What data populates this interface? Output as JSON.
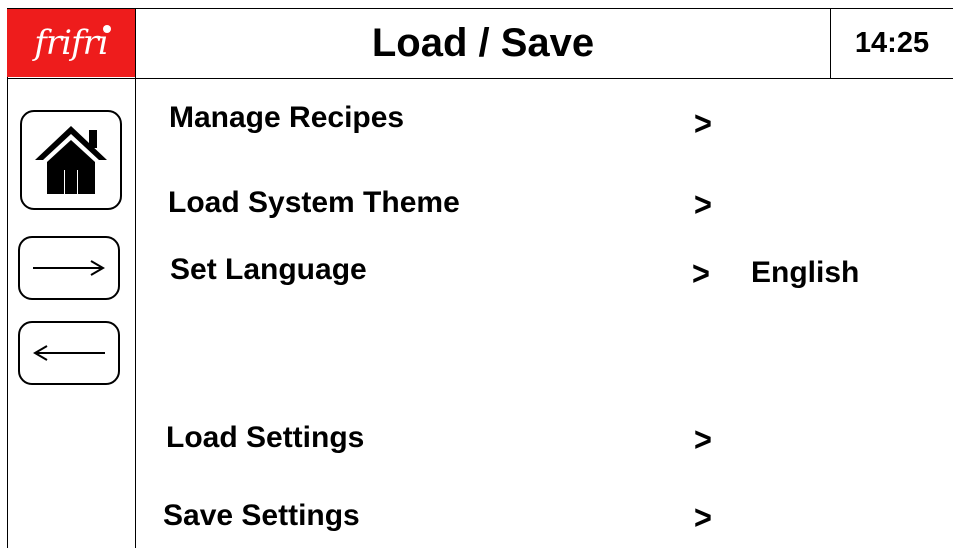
{
  "brand": {
    "logo_text": "frifri",
    "accent_color": "#ee1c1c"
  },
  "header": {
    "title": "Load / Save",
    "clock": "14:25"
  },
  "sidebar": [
    {
      "name": "home-button",
      "icon": "home-icon"
    },
    {
      "name": "forward-button",
      "icon": "arrow-right-icon"
    },
    {
      "name": "back-button",
      "icon": "arrow-left-icon"
    }
  ],
  "menu": {
    "manage_recipes": {
      "label": "Manage Recipes",
      "arrow": ">"
    },
    "load_system_theme": {
      "label": "Load System Theme",
      "arrow": ">"
    },
    "set_language": {
      "label": "Set Language",
      "arrow": ">",
      "value": "English"
    },
    "load_settings": {
      "label": "Load Settings",
      "arrow": ">"
    },
    "save_settings": {
      "label": "Save Settings",
      "arrow": ">"
    }
  }
}
